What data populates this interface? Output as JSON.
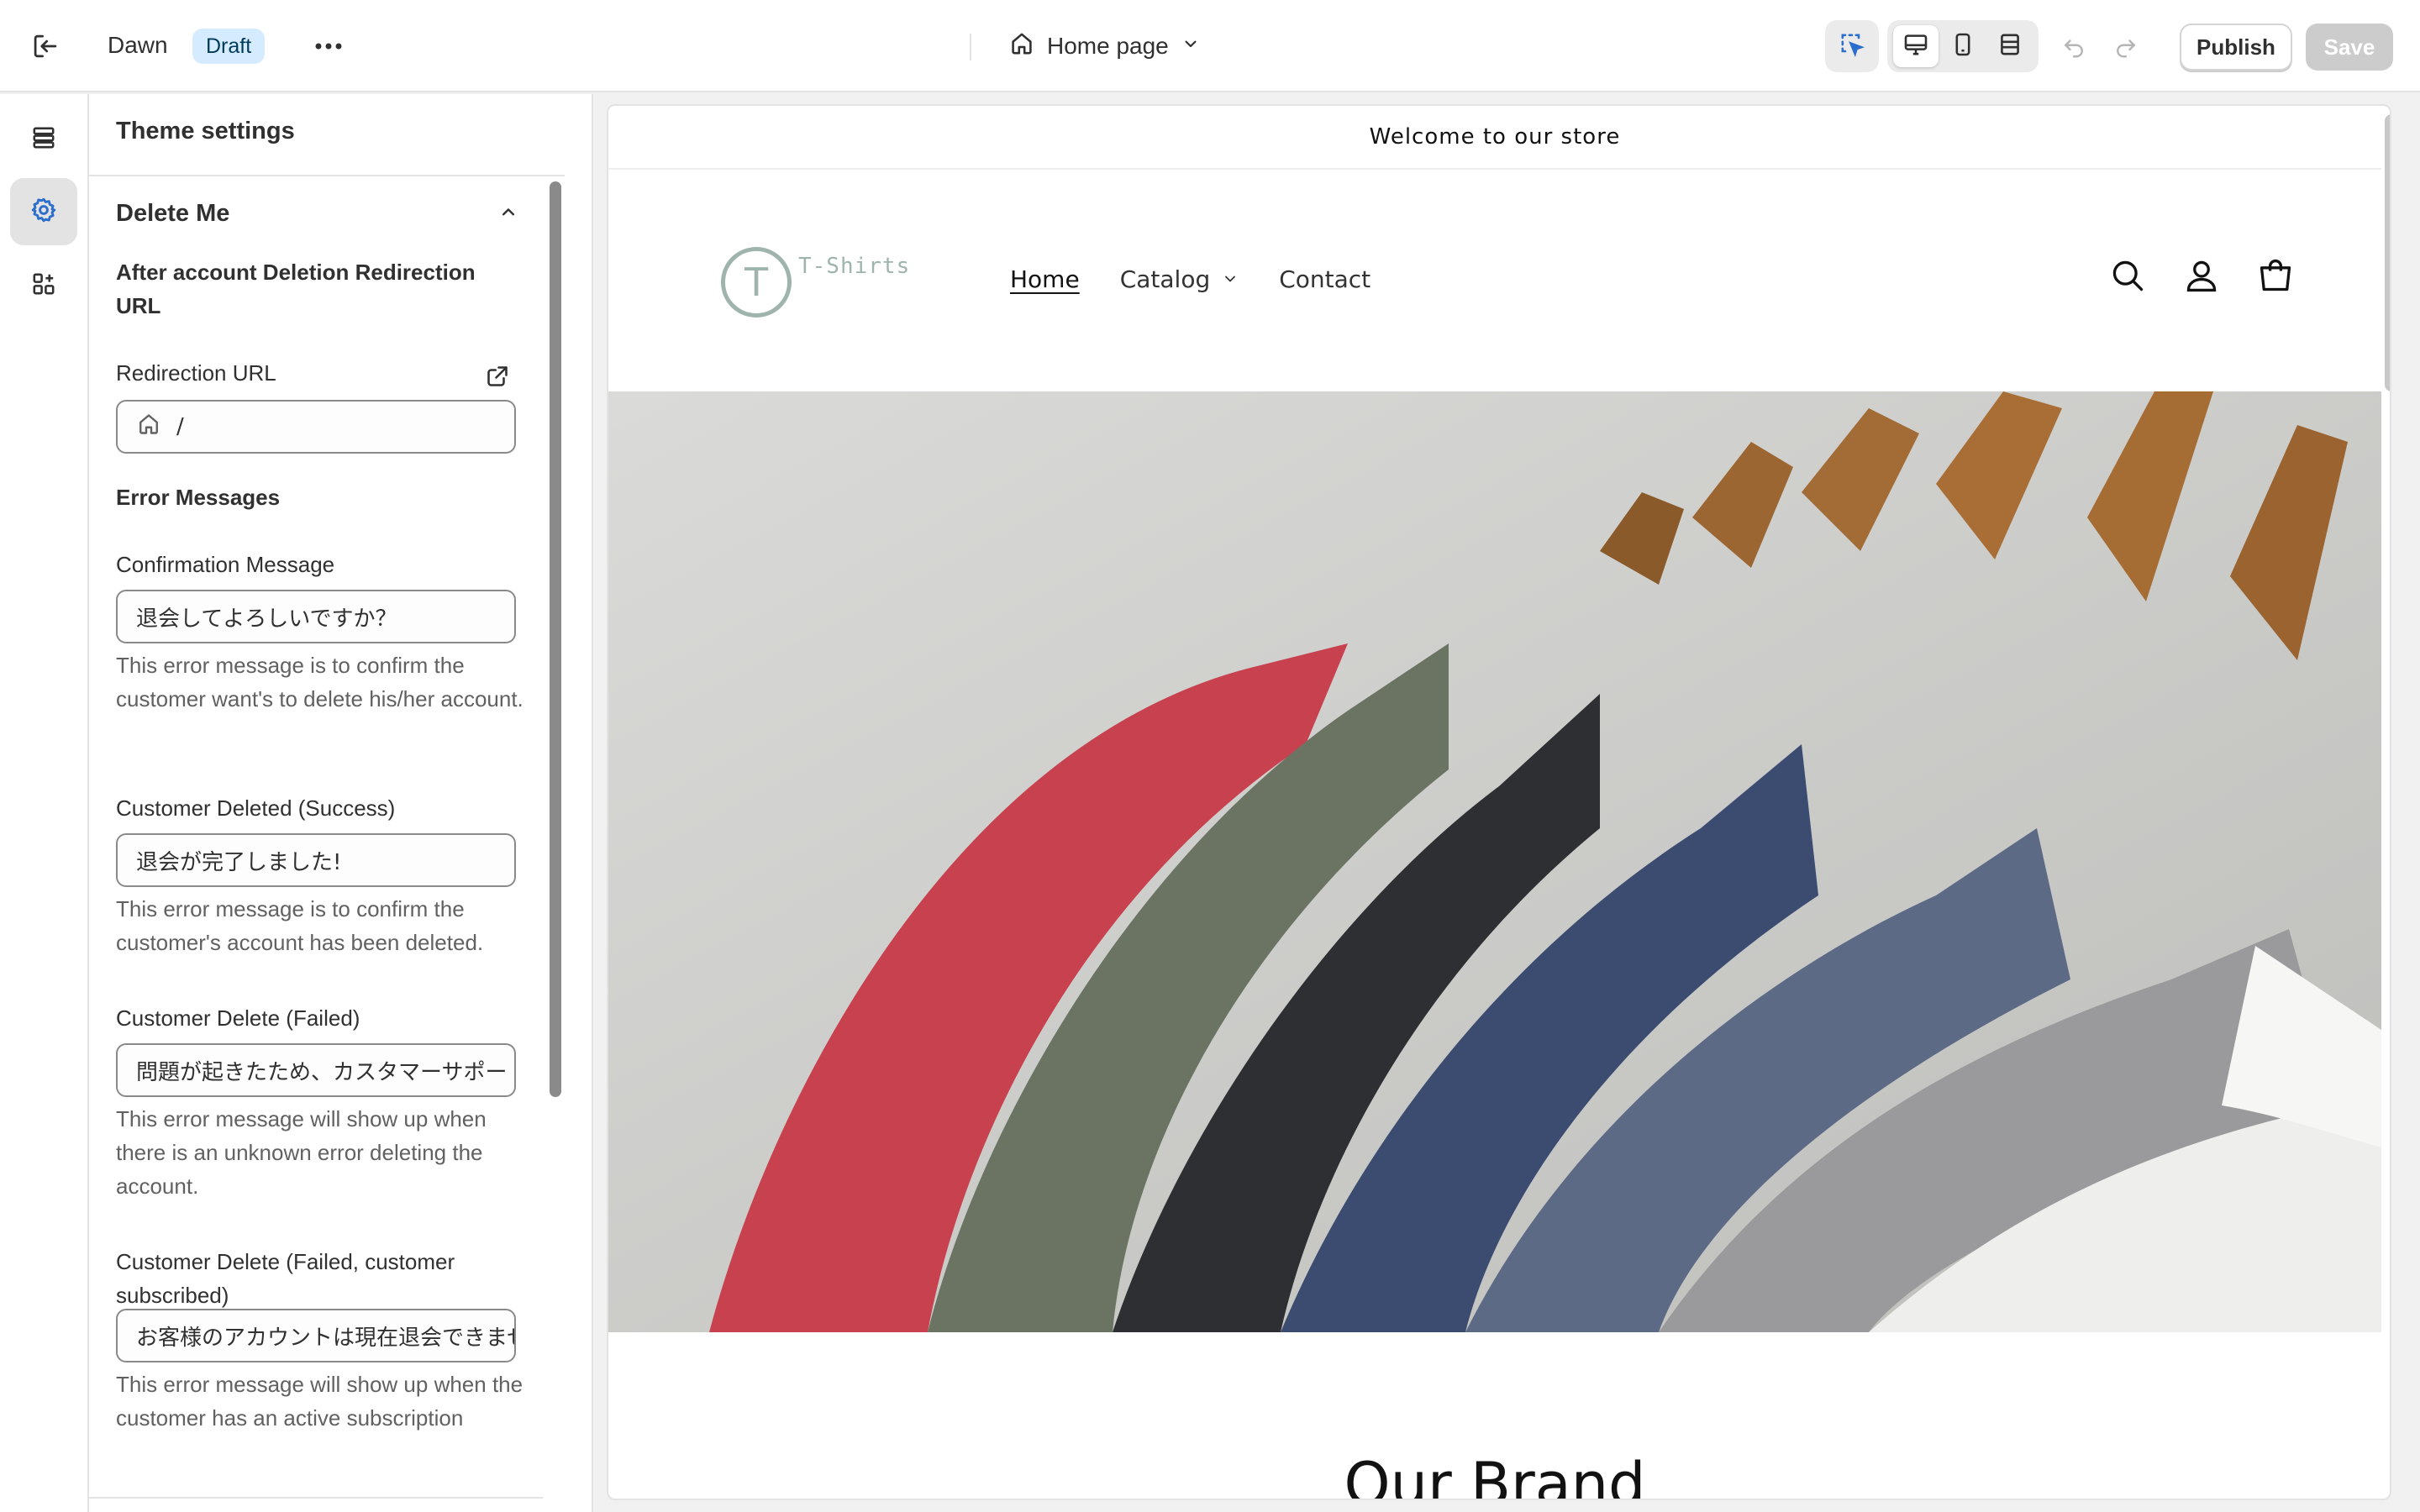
{
  "topbar": {
    "theme_name": "Dawn",
    "theme_status": "Draft",
    "page_selector": "Home page",
    "publish_label": "Publish",
    "save_label": "Save"
  },
  "icons": {
    "exit": "exit-icon",
    "more": "more-horizontal-icon",
    "home": "home-icon",
    "chevron": "chevron-down-icon",
    "inspector": "select-cursor-icon",
    "desktop": "desktop-icon",
    "mobile": "mobile-icon",
    "fullscreen": "fullscreen-icon",
    "undo": "undo-icon",
    "redo": "redo-icon",
    "sections": "sections-icon",
    "settings": "gear-icon",
    "apps": "apps-icon",
    "external": "external-link-icon",
    "search": "search-icon",
    "account": "account-icon",
    "cart": "cart-icon"
  },
  "colors": {
    "draft_badge_bg": "#d5ebff",
    "save_disabled_bg": "#cccccc",
    "logo_tint": "#9fb4ad"
  },
  "panel": {
    "title": "Theme settings",
    "section_title": "Delete Me",
    "redirect_heading": "After account Deletion Redirection URL",
    "redirect_label": "Redirection URL",
    "redirect_value": "/",
    "errors_heading": "Error Messages",
    "fields": [
      {
        "label": "Confirmation Message",
        "value": "退会してよろしいですか？",
        "help": "This error message is to confirm the customer want's to delete his/her account."
      },
      {
        "label": "Customer Deleted (Success)",
        "value": "退会が完了しました!",
        "help": "This error message is to confirm the customer's account has been deleted."
      },
      {
        "label": "Customer Delete (Failed)",
        "value": "問題が起きたため、カスタマーサポートへお問い合わせください",
        "help": "This error message will show up when there is an unknown error deleting the account."
      },
      {
        "label": "Customer Delete (Failed, customer subscribed)",
        "value": "お客様のアカウントは現在退会できません",
        "help": "This error message will show up when the customer has an active subscription"
      }
    ]
  },
  "preview": {
    "announcement": "Welcome to our store",
    "logo_letter": "T",
    "logo_text": "T-Shirts",
    "nav": {
      "home": "Home",
      "catalog": "Catalog",
      "contact": "Contact"
    },
    "section_heading": "Our Brand"
  }
}
